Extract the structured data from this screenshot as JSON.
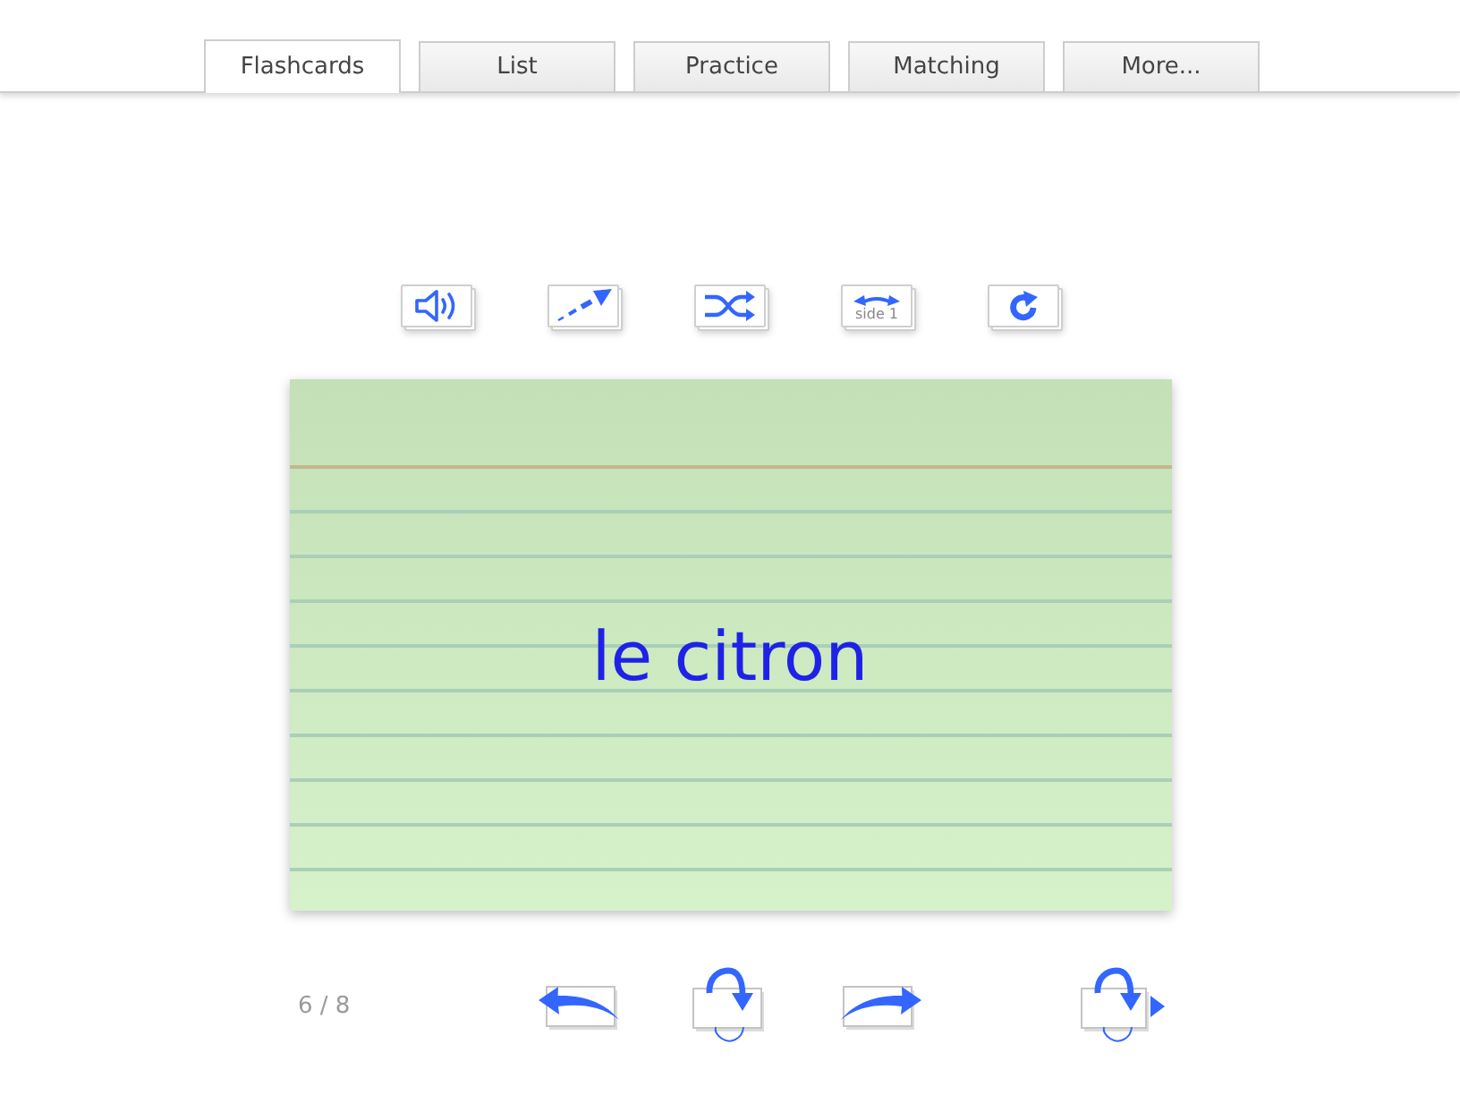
{
  "tabs": [
    {
      "label": "Flashcards",
      "selected": true
    },
    {
      "label": "List",
      "selected": false
    },
    {
      "label": "Practice",
      "selected": false
    },
    {
      "label": "Matching",
      "selected": false
    },
    {
      "label": "More...",
      "selected": false
    }
  ],
  "toolbar": [
    {
      "kind": "audio"
    },
    {
      "kind": "hint"
    },
    {
      "kind": "shuffle"
    },
    {
      "kind": "side",
      "label": "side 1"
    },
    {
      "kind": "restart"
    }
  ],
  "card": {
    "text": "le citron"
  },
  "counter": "6 / 8",
  "navigation": [
    {
      "kind": "previous"
    },
    {
      "kind": "flip"
    },
    {
      "kind": "next"
    },
    {
      "kind": "flip_next"
    }
  ]
}
